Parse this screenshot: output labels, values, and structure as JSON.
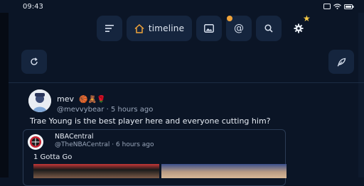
{
  "status_bar": {
    "time": "09:43",
    "icons": [
      "sim-icon",
      "notification-icon",
      "wifi-icon",
      "battery-icon"
    ],
    "battery": "◻"
  },
  "toolbar": {
    "menu_icon": "menu-icon",
    "timeline_label": "timeline",
    "gallery_icon": "image-icon",
    "mention_label": "@",
    "search_icon": "search-icon",
    "settings_icon": "gear-icon",
    "notification_dot_color": "#f0a33a",
    "star": "★"
  },
  "post": {
    "author": "mev",
    "emojis": "🏀🧸🌹",
    "handle": "@mevvybear",
    "time": "5 hours ago",
    "text": "Trae Young is the best player here and everyone cutting him?"
  },
  "quote": {
    "name": "NBACentral",
    "handle": "@TheNBACentral",
    "time": "6 hours ago",
    "text": "1 Gotta Go"
  },
  "colors": {
    "background": "#0b1526",
    "button": "#15253e",
    "accent_orange": "#f0a33a",
    "star": "#f6c945"
  }
}
